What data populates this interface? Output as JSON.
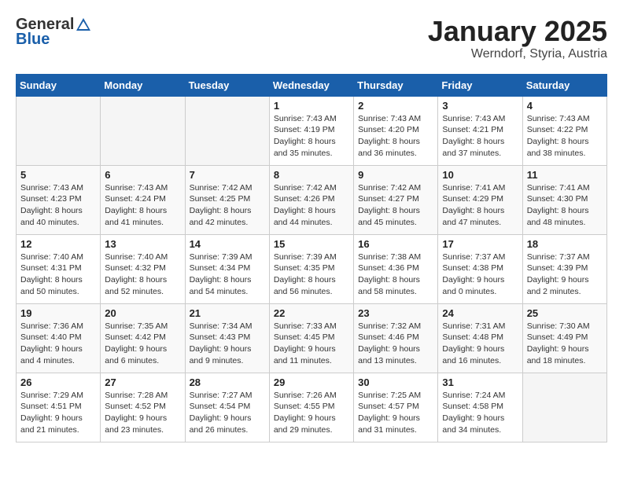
{
  "header": {
    "logo_general": "General",
    "logo_blue": "Blue",
    "month_title": "January 2025",
    "subtitle": "Werndorf, Styria, Austria"
  },
  "weekdays": [
    "Sunday",
    "Monday",
    "Tuesday",
    "Wednesday",
    "Thursday",
    "Friday",
    "Saturday"
  ],
  "weeks": [
    [
      {
        "day": "",
        "content": ""
      },
      {
        "day": "",
        "content": ""
      },
      {
        "day": "",
        "content": ""
      },
      {
        "day": "1",
        "content": "Sunrise: 7:43 AM\nSunset: 4:19 PM\nDaylight: 8 hours\nand 35 minutes."
      },
      {
        "day": "2",
        "content": "Sunrise: 7:43 AM\nSunset: 4:20 PM\nDaylight: 8 hours\nand 36 minutes."
      },
      {
        "day": "3",
        "content": "Sunrise: 7:43 AM\nSunset: 4:21 PM\nDaylight: 8 hours\nand 37 minutes."
      },
      {
        "day": "4",
        "content": "Sunrise: 7:43 AM\nSunset: 4:22 PM\nDaylight: 8 hours\nand 38 minutes."
      }
    ],
    [
      {
        "day": "5",
        "content": "Sunrise: 7:43 AM\nSunset: 4:23 PM\nDaylight: 8 hours\nand 40 minutes."
      },
      {
        "day": "6",
        "content": "Sunrise: 7:43 AM\nSunset: 4:24 PM\nDaylight: 8 hours\nand 41 minutes."
      },
      {
        "day": "7",
        "content": "Sunrise: 7:42 AM\nSunset: 4:25 PM\nDaylight: 8 hours\nand 42 minutes."
      },
      {
        "day": "8",
        "content": "Sunrise: 7:42 AM\nSunset: 4:26 PM\nDaylight: 8 hours\nand 44 minutes."
      },
      {
        "day": "9",
        "content": "Sunrise: 7:42 AM\nSunset: 4:27 PM\nDaylight: 8 hours\nand 45 minutes."
      },
      {
        "day": "10",
        "content": "Sunrise: 7:41 AM\nSunset: 4:29 PM\nDaylight: 8 hours\nand 47 minutes."
      },
      {
        "day": "11",
        "content": "Sunrise: 7:41 AM\nSunset: 4:30 PM\nDaylight: 8 hours\nand 48 minutes."
      }
    ],
    [
      {
        "day": "12",
        "content": "Sunrise: 7:40 AM\nSunset: 4:31 PM\nDaylight: 8 hours\nand 50 minutes."
      },
      {
        "day": "13",
        "content": "Sunrise: 7:40 AM\nSunset: 4:32 PM\nDaylight: 8 hours\nand 52 minutes."
      },
      {
        "day": "14",
        "content": "Sunrise: 7:39 AM\nSunset: 4:34 PM\nDaylight: 8 hours\nand 54 minutes."
      },
      {
        "day": "15",
        "content": "Sunrise: 7:39 AM\nSunset: 4:35 PM\nDaylight: 8 hours\nand 56 minutes."
      },
      {
        "day": "16",
        "content": "Sunrise: 7:38 AM\nSunset: 4:36 PM\nDaylight: 8 hours\nand 58 minutes."
      },
      {
        "day": "17",
        "content": "Sunrise: 7:37 AM\nSunset: 4:38 PM\nDaylight: 9 hours\nand 0 minutes."
      },
      {
        "day": "18",
        "content": "Sunrise: 7:37 AM\nSunset: 4:39 PM\nDaylight: 9 hours\nand 2 minutes."
      }
    ],
    [
      {
        "day": "19",
        "content": "Sunrise: 7:36 AM\nSunset: 4:40 PM\nDaylight: 9 hours\nand 4 minutes."
      },
      {
        "day": "20",
        "content": "Sunrise: 7:35 AM\nSunset: 4:42 PM\nDaylight: 9 hours\nand 6 minutes."
      },
      {
        "day": "21",
        "content": "Sunrise: 7:34 AM\nSunset: 4:43 PM\nDaylight: 9 hours\nand 9 minutes."
      },
      {
        "day": "22",
        "content": "Sunrise: 7:33 AM\nSunset: 4:45 PM\nDaylight: 9 hours\nand 11 minutes."
      },
      {
        "day": "23",
        "content": "Sunrise: 7:32 AM\nSunset: 4:46 PM\nDaylight: 9 hours\nand 13 minutes."
      },
      {
        "day": "24",
        "content": "Sunrise: 7:31 AM\nSunset: 4:48 PM\nDaylight: 9 hours\nand 16 minutes."
      },
      {
        "day": "25",
        "content": "Sunrise: 7:30 AM\nSunset: 4:49 PM\nDaylight: 9 hours\nand 18 minutes."
      }
    ],
    [
      {
        "day": "26",
        "content": "Sunrise: 7:29 AM\nSunset: 4:51 PM\nDaylight: 9 hours\nand 21 minutes."
      },
      {
        "day": "27",
        "content": "Sunrise: 7:28 AM\nSunset: 4:52 PM\nDaylight: 9 hours\nand 23 minutes."
      },
      {
        "day": "28",
        "content": "Sunrise: 7:27 AM\nSunset: 4:54 PM\nDaylight: 9 hours\nand 26 minutes."
      },
      {
        "day": "29",
        "content": "Sunrise: 7:26 AM\nSunset: 4:55 PM\nDaylight: 9 hours\nand 29 minutes."
      },
      {
        "day": "30",
        "content": "Sunrise: 7:25 AM\nSunset: 4:57 PM\nDaylight: 9 hours\nand 31 minutes."
      },
      {
        "day": "31",
        "content": "Sunrise: 7:24 AM\nSunset: 4:58 PM\nDaylight: 9 hours\nand 34 minutes."
      },
      {
        "day": "",
        "content": ""
      }
    ]
  ]
}
